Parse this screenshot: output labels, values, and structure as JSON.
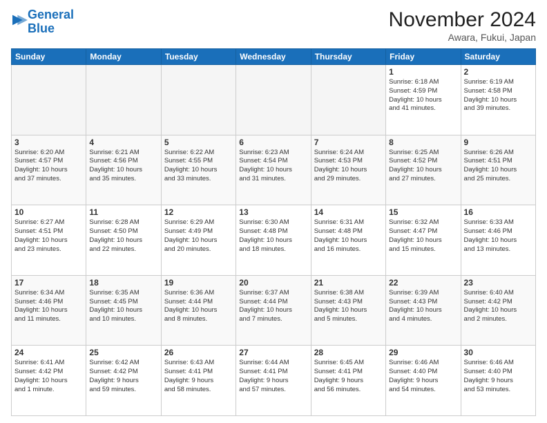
{
  "header": {
    "logo_line1": "General",
    "logo_line2": "Blue",
    "month": "November 2024",
    "location": "Awara, Fukui, Japan"
  },
  "weekdays": [
    "Sunday",
    "Monday",
    "Tuesday",
    "Wednesday",
    "Thursday",
    "Friday",
    "Saturday"
  ],
  "weeks": [
    [
      {
        "day": "",
        "info": ""
      },
      {
        "day": "",
        "info": ""
      },
      {
        "day": "",
        "info": ""
      },
      {
        "day": "",
        "info": ""
      },
      {
        "day": "",
        "info": ""
      },
      {
        "day": "1",
        "info": "Sunrise: 6:18 AM\nSunset: 4:59 PM\nDaylight: 10 hours\nand 41 minutes."
      },
      {
        "day": "2",
        "info": "Sunrise: 6:19 AM\nSunset: 4:58 PM\nDaylight: 10 hours\nand 39 minutes."
      }
    ],
    [
      {
        "day": "3",
        "info": "Sunrise: 6:20 AM\nSunset: 4:57 PM\nDaylight: 10 hours\nand 37 minutes."
      },
      {
        "day": "4",
        "info": "Sunrise: 6:21 AM\nSunset: 4:56 PM\nDaylight: 10 hours\nand 35 minutes."
      },
      {
        "day": "5",
        "info": "Sunrise: 6:22 AM\nSunset: 4:55 PM\nDaylight: 10 hours\nand 33 minutes."
      },
      {
        "day": "6",
        "info": "Sunrise: 6:23 AM\nSunset: 4:54 PM\nDaylight: 10 hours\nand 31 minutes."
      },
      {
        "day": "7",
        "info": "Sunrise: 6:24 AM\nSunset: 4:53 PM\nDaylight: 10 hours\nand 29 minutes."
      },
      {
        "day": "8",
        "info": "Sunrise: 6:25 AM\nSunset: 4:52 PM\nDaylight: 10 hours\nand 27 minutes."
      },
      {
        "day": "9",
        "info": "Sunrise: 6:26 AM\nSunset: 4:51 PM\nDaylight: 10 hours\nand 25 minutes."
      }
    ],
    [
      {
        "day": "10",
        "info": "Sunrise: 6:27 AM\nSunset: 4:51 PM\nDaylight: 10 hours\nand 23 minutes."
      },
      {
        "day": "11",
        "info": "Sunrise: 6:28 AM\nSunset: 4:50 PM\nDaylight: 10 hours\nand 22 minutes."
      },
      {
        "day": "12",
        "info": "Sunrise: 6:29 AM\nSunset: 4:49 PM\nDaylight: 10 hours\nand 20 minutes."
      },
      {
        "day": "13",
        "info": "Sunrise: 6:30 AM\nSunset: 4:48 PM\nDaylight: 10 hours\nand 18 minutes."
      },
      {
        "day": "14",
        "info": "Sunrise: 6:31 AM\nSunset: 4:48 PM\nDaylight: 10 hours\nand 16 minutes."
      },
      {
        "day": "15",
        "info": "Sunrise: 6:32 AM\nSunset: 4:47 PM\nDaylight: 10 hours\nand 15 minutes."
      },
      {
        "day": "16",
        "info": "Sunrise: 6:33 AM\nSunset: 4:46 PM\nDaylight: 10 hours\nand 13 minutes."
      }
    ],
    [
      {
        "day": "17",
        "info": "Sunrise: 6:34 AM\nSunset: 4:46 PM\nDaylight: 10 hours\nand 11 minutes."
      },
      {
        "day": "18",
        "info": "Sunrise: 6:35 AM\nSunset: 4:45 PM\nDaylight: 10 hours\nand 10 minutes."
      },
      {
        "day": "19",
        "info": "Sunrise: 6:36 AM\nSunset: 4:44 PM\nDaylight: 10 hours\nand 8 minutes."
      },
      {
        "day": "20",
        "info": "Sunrise: 6:37 AM\nSunset: 4:44 PM\nDaylight: 10 hours\nand 7 minutes."
      },
      {
        "day": "21",
        "info": "Sunrise: 6:38 AM\nSunset: 4:43 PM\nDaylight: 10 hours\nand 5 minutes."
      },
      {
        "day": "22",
        "info": "Sunrise: 6:39 AM\nSunset: 4:43 PM\nDaylight: 10 hours\nand 4 minutes."
      },
      {
        "day": "23",
        "info": "Sunrise: 6:40 AM\nSunset: 4:42 PM\nDaylight: 10 hours\nand 2 minutes."
      }
    ],
    [
      {
        "day": "24",
        "info": "Sunrise: 6:41 AM\nSunset: 4:42 PM\nDaylight: 10 hours\nand 1 minute."
      },
      {
        "day": "25",
        "info": "Sunrise: 6:42 AM\nSunset: 4:42 PM\nDaylight: 9 hours\nand 59 minutes."
      },
      {
        "day": "26",
        "info": "Sunrise: 6:43 AM\nSunset: 4:41 PM\nDaylight: 9 hours\nand 58 minutes."
      },
      {
        "day": "27",
        "info": "Sunrise: 6:44 AM\nSunset: 4:41 PM\nDaylight: 9 hours\nand 57 minutes."
      },
      {
        "day": "28",
        "info": "Sunrise: 6:45 AM\nSunset: 4:41 PM\nDaylight: 9 hours\nand 56 minutes."
      },
      {
        "day": "29",
        "info": "Sunrise: 6:46 AM\nSunset: 4:40 PM\nDaylight: 9 hours\nand 54 minutes."
      },
      {
        "day": "30",
        "info": "Sunrise: 6:46 AM\nSunset: 4:40 PM\nDaylight: 9 hours\nand 53 minutes."
      }
    ]
  ]
}
